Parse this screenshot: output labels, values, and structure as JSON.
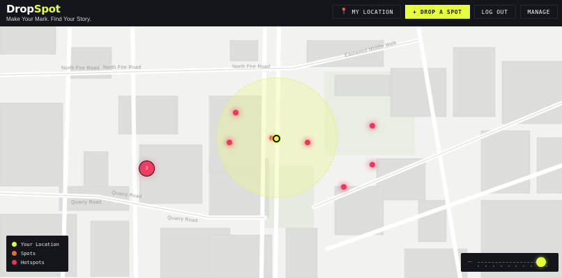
{
  "brand": {
    "logo_part1": "Drop",
    "logo_part2": "Spot",
    "tagline": "Make Your Mark. Find Your Story."
  },
  "nav": {
    "my_location": "MY LOCATION",
    "drop_spot": "+ DROP A SPOT",
    "logout": "LOG OUT",
    "manage": "MANAGE"
  },
  "map": {
    "roads": {
      "north_fire_1": "North Fire Road",
      "north_fire_2": "North Fire Road",
      "north_fire_3": "North Fire Road",
      "eastwood": "Eastwood Middle Walk",
      "quarry_1": "Quarry Road",
      "quarry_2": "Quarry Road",
      "quarry_3": "Quarry Road"
    },
    "cluster_count": "3"
  },
  "legend": {
    "your_location": "Your Location",
    "spots": "Spots",
    "hotspots": "Hotspots"
  },
  "colors": {
    "accent": "#e5ff3f",
    "hotspot": "#f0345a",
    "spot": "#f26a3b",
    "header_bg": "#15161c"
  },
  "zoom": {
    "minus_label": "–",
    "level_fraction": 0.91
  }
}
